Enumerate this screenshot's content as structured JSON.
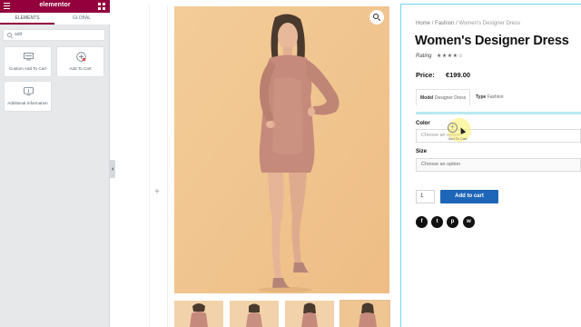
{
  "panel": {
    "brand": "elementor",
    "tabs": [
      "ELEMENTS",
      "GLOBAL"
    ],
    "search_value": "add",
    "widgets": [
      "Custom Add To Cart",
      "Add To Cart",
      "Additional Information"
    ]
  },
  "canvas": {
    "add_symbol": "+"
  },
  "product": {
    "breadcrumb": {
      "home": "Home",
      "category": "Fashion",
      "current": "Women's Designer Dress"
    },
    "title": "Women's Designer Dress",
    "rating_label": "Rating",
    "stars": "★★★★☆",
    "price_label": "Price:",
    "price": "€199.00",
    "attributes": [
      {
        "label": "Model",
        "value": "Designer Dress"
      },
      {
        "label": "Type",
        "value": "Fashion"
      }
    ],
    "color_label": "Color",
    "color_placeholder": "Choose an option",
    "size_label": "Size",
    "size_placeholder": "Choose an option",
    "quantity": "1",
    "add_to_cart": "Add to cart",
    "drag_label": "Add To Cart",
    "social": [
      "f",
      "t",
      "p",
      "w"
    ]
  },
  "colors": {
    "brand": "#93003c",
    "button": "#1e66b8",
    "photo_bg": "#f0c58f",
    "dress": "#c58a7b",
    "guide": "#71d7f7"
  }
}
